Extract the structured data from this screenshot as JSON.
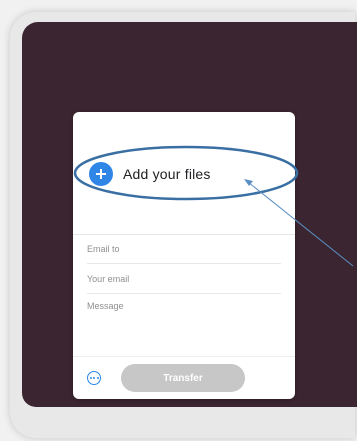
{
  "upload_card": {
    "add_files_label": "Add your files",
    "fields": [
      {
        "label": "Email to"
      },
      {
        "label": "Your email"
      },
      {
        "label": "Message"
      }
    ],
    "transfer_label": "Transfer"
  },
  "icons": {
    "add": "plus-icon",
    "more": "more-options-icon"
  },
  "colors": {
    "screen_background": "#3b2530",
    "accent_blue": "#2f86e6",
    "annotation_ring": "#3a6fa3",
    "transfer_disabled": "#c7c7c7"
  }
}
